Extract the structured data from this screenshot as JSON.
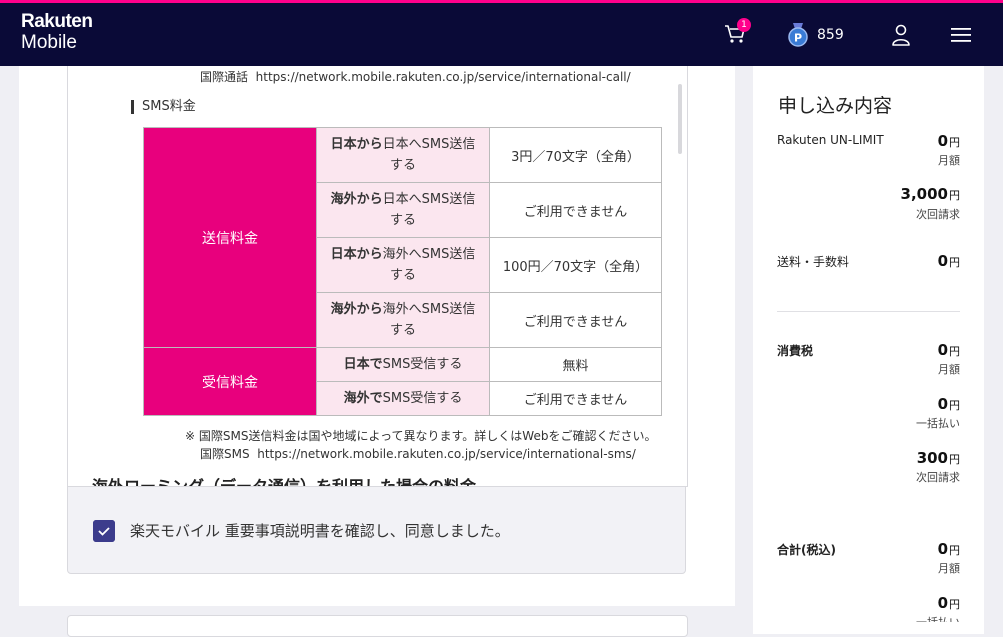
{
  "brand": {
    "line1": "Rakuten",
    "line2": "Mobile"
  },
  "header": {
    "cart_count": "1",
    "points": "859"
  },
  "intl_call": {
    "label": "国際通話",
    "url": "https://network.mobile.rakuten.co.jp/service/international-call/"
  },
  "sms": {
    "heading": "SMS料金",
    "send_category": "送信料金",
    "receive_category": "受信料金",
    "rows": [
      {
        "bold": "日本から",
        "rest": "日本へSMS送信",
        "line2": "する",
        "value": "3円／70文字（全角）"
      },
      {
        "bold": "海外から",
        "rest": "日本へSMS送信",
        "line2": "する",
        "value": "ご利用できません"
      },
      {
        "bold": "日本から",
        "rest": "海外へSMS送信",
        "line2": "する",
        "value": "100円／70文字（全角）"
      },
      {
        "bold": "海外から",
        "rest": "海外へSMS送信",
        "line2": "する",
        "value": "ご利用できません"
      },
      {
        "bold": "日本で",
        "rest": "SMS受信する",
        "line2": "",
        "value": "無料"
      },
      {
        "bold": "海外で",
        "rest": "SMS受信する",
        "line2": "",
        "value": "ご利用できません"
      }
    ],
    "note": "※ 国際SMS送信料金は国や地域によって異なります。詳しくはWebをご確認ください。",
    "intl_label": "国際SMS",
    "intl_url": "https://network.mobile.rakuten.co.jp/service/international-sms/"
  },
  "cutoff_heading": "海外ローミング（データ通信）を利用した場合の料金",
  "agreement": {
    "text": "楽天モバイル 重要事項説明書を確認し、同意しました。",
    "checked": true
  },
  "summary": {
    "title": "申し込み内容",
    "plan_label": "Rakuten UN-LIMIT",
    "plan_monthly": "0",
    "monthly_label": "月額",
    "plan_next": "3,000",
    "next_label": "次回請求",
    "fee_label": "送料・手数料",
    "fee_amount": "0",
    "tax_label": "消費税",
    "tax_monthly": "0",
    "tax_once": "0",
    "once_label": "一括払い",
    "tax_next": "300",
    "total_label": "合計(税込)",
    "total_monthly": "0",
    "total_once": "0",
    "yen": "円"
  }
}
